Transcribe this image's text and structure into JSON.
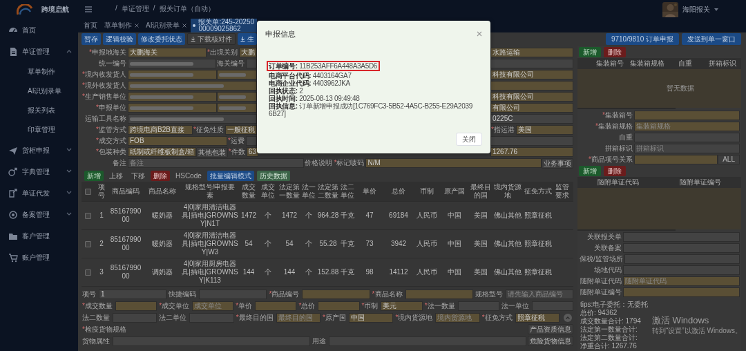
{
  "sidebar": {
    "app_name": "跨境启航",
    "items": [
      {
        "label": "首页"
      },
      {
        "label": "单证管理",
        "expanded": true,
        "children": [
          {
            "label": "草单制作"
          },
          {
            "label": "AI识别录单"
          },
          {
            "label": "报关列表"
          },
          {
            "label": "印章管理"
          }
        ]
      },
      {
        "label": "货柜申报",
        "expanded": false
      },
      {
        "label": "字典管理",
        "expanded": false
      },
      {
        "label": "单证代发",
        "expanded": false
      },
      {
        "label": "备案管理",
        "expanded": false
      },
      {
        "label": "客户管理"
      },
      {
        "label": "账户管理"
      }
    ]
  },
  "header": {
    "separator": "/",
    "breadcrumb": [
      "单证管理",
      "报关订单（自动）"
    ],
    "user": "海阳报关"
  },
  "tabs": [
    {
      "label": "首页",
      "selected": false,
      "closable": false
    },
    {
      "label": "草单制作",
      "selected": false,
      "closable": true
    },
    {
      "label": "AI识别录单",
      "selected": false,
      "closable": true
    },
    {
      "label": "报关单:245-2025000009025862",
      "selected": true,
      "closable": false
    }
  ],
  "toolbar": [
    {
      "label": "暂存",
      "kind": "primary"
    },
    {
      "label": "逻辑校验",
      "kind": "primary"
    },
    {
      "label": "修改委托状态",
      "kind": "primary"
    },
    {
      "label": "下载核对件",
      "kind": "download"
    },
    {
      "label": "生",
      "kind": "download-primary"
    }
  ],
  "actions": [
    {
      "label": "9710/9810 订单申报",
      "kind": "primary"
    },
    {
      "label": "发送到单一窗口",
      "kind": "primary"
    }
  ],
  "form": {
    "lines": [
      {
        "left": [
          {
            "kind": "label",
            "mark": "*",
            "text": "申报地海关"
          },
          {
            "kind": "input",
            "value": "大鹏海关",
            "required": true
          },
          {
            "kind": "label",
            "mark": "*",
            "text": "出境关别"
          },
          {
            "kind": "input",
            "value": "大鹏",
            "required": true
          }
        ],
        "right": [
          {
            "kind": "input",
            "value": "水路运输",
            "required": true
          }
        ]
      },
      {
        "left": [
          {
            "kind": "label",
            "text": "统一编号"
          },
          {
            "kind": "redacted",
            "required": false
          },
          {
            "kind": "label",
            "text": "海关编号"
          },
          {
            "kind": "input",
            "required": false
          }
        ],
        "right": [
          {
            "kind": "input",
            "required": false
          }
        ]
      },
      {
        "left": [
          {
            "kind": "label",
            "mark": "*",
            "text": "境内收发货人"
          },
          {
            "kind": "redacted",
            "required": true
          },
          {
            "kind": "redacted",
            "required": true
          }
        ],
        "right": [
          {
            "kind": "input",
            "value": "科技有限公司",
            "required": true
          }
        ]
      },
      {
        "left": [
          {
            "kind": "label",
            "mark": "*",
            "text": "境外收发货人"
          },
          {
            "kind": "redacted",
            "required": true
          }
        ],
        "right": [
          {
            "kind": "input",
            "required": true
          }
        ]
      },
      {
        "left": [
          {
            "kind": "label",
            "mark": "*",
            "text": "生产销售单位"
          },
          {
            "kind": "redacted",
            "required": true
          },
          {
            "kind": "redacted",
            "required": true
          }
        ],
        "right": [
          {
            "kind": "input",
            "value": "科技有限公司",
            "required": true
          }
        ]
      },
      {
        "left": [
          {
            "kind": "label",
            "mark": "*",
            "text": "申报单位"
          },
          {
            "kind": "redacted",
            "required": true
          },
          {
            "kind": "redacted",
            "required": true
          }
        ],
        "right": [
          {
            "kind": "input",
            "value": "有限公司",
            "required": true
          }
        ]
      },
      {
        "left": [
          {
            "kind": "label",
            "text": "运输工具名称"
          },
          {
            "kind": "redacted",
            "required": false
          }
        ],
        "right": [
          {
            "kind": "input",
            "value": "0225C",
            "required": false
          }
        ]
      },
      {
        "left": [
          {
            "kind": "label",
            "mark": "*",
            "text": "监管方式"
          },
          {
            "kind": "input",
            "value": "跨境电商B2B直接",
            "required": true
          },
          {
            "kind": "label",
            "mark": "*",
            "text": "征免性质"
          },
          {
            "kind": "input",
            "value": "一般征税",
            "required": true
          }
        ],
        "right": [
          {
            "kind": "label",
            "mark": "*",
            "text": "指运港"
          },
          {
            "kind": "input",
            "value": "美国",
            "required": true
          }
        ]
      },
      {
        "left": [
          {
            "kind": "label",
            "mark": "*",
            "text": "成交方式"
          },
          {
            "kind": "input",
            "value": "FOB",
            "required": true
          },
          {
            "kind": "label",
            "mark": "*",
            "text": "运费"
          },
          {
            "kind": "input",
            "required": false
          }
        ],
        "right": [
          {
            "kind": "input",
            "required": false
          }
        ]
      },
      {
        "left": [
          {
            "kind": "label",
            "mark": "*",
            "text": "包装种类"
          },
          {
            "kind": "input",
            "value": "纸制或纤维板制盒/箱",
            "required": true
          },
          {
            "kind": "button",
            "text": "其他包装"
          },
          {
            "kind": "label",
            "mark": "*",
            "text": "件数"
          },
          {
            "kind": "input",
            "value": "63",
            "required": true
          }
        ],
        "right": [
          {
            "kind": "input",
            "value": "1267.76",
            "required": true
          }
        ]
      },
      {
        "fields": [
          {
            "kind": "label",
            "text": "备注"
          },
          {
            "kind": "input",
            "placeholder": "备注",
            "required": false
          },
          {
            "kind": "label",
            "text": "价格说明"
          },
          {
            "kind": "label",
            "mark": "*",
            "text": "标记唛码"
          },
          {
            "kind": "input",
            "value": "N/M",
            "required": true
          },
          {
            "kind": "button",
            "text": "业务事项"
          }
        ]
      }
    ]
  },
  "goods": {
    "buttons": [
      {
        "label": "新增",
        "kind": "add"
      },
      {
        "label": "上移",
        "kind": "plain"
      },
      {
        "label": "下移",
        "kind": "plain"
      },
      {
        "label": "删除",
        "kind": "delete"
      },
      {
        "label": "HSCode",
        "kind": "plain"
      },
      {
        "label": "批量编辑模式",
        "kind": "primary"
      },
      {
        "label": "历史数据",
        "kind": "history"
      }
    ],
    "all_checked": false,
    "columns": [
      "项号",
      "商品编码",
      "商品名称",
      "规格型号/申报要素",
      "成交数量",
      "成交单位",
      "法定第一数量",
      "法一单位",
      "法定第二数量",
      "法二单位",
      "单价",
      "总价",
      "币制",
      "原产国",
      "最终目的国",
      "境内货源地",
      "征免方式",
      "监管要求"
    ],
    "rows": [
      {
        "checked": false,
        "cells": [
          "1",
          "8516799000",
          "暖奶器",
          "4|0|家用清洁电器具|插电|GROWNSY|N1T",
          "1472",
          "个",
          "1472",
          "个",
          "964.28",
          "千克",
          "47",
          "69184",
          "人民币",
          "中国",
          "美国",
          "佛山其他",
          "照章征税",
          ""
        ]
      },
      {
        "checked": false,
        "cells": [
          "2",
          "8516799000",
          "暖奶器",
          "4|0|家用清洁电器具|插电|GROWNSY|W3",
          "54",
          "个",
          "54",
          "个",
          "55.28",
          "千克",
          "73",
          "3942",
          "人民币",
          "中国",
          "美国",
          "佛山其他",
          "照章征税",
          ""
        ]
      },
      {
        "checked": false,
        "cells": [
          "3",
          "8516799000",
          "调奶器",
          "4|0|家用厨房电器具|插电|GROWNSY|K113",
          "144",
          "个",
          "144",
          "个",
          "152.88",
          "千克",
          "98",
          "14112",
          "人民币",
          "中国",
          "美国",
          "佛山其他",
          "照章征税",
          ""
        ]
      }
    ]
  },
  "goods_form": {
    "lines": [
      {
        "fields": [
          {
            "kind": "label",
            "text": "项号"
          },
          {
            "kind": "input",
            "value": "1",
            "required": false
          },
          {
            "kind": "label",
            "text": "快捷编码"
          },
          {
            "kind": "input",
            "required": false
          },
          {
            "kind": "label",
            "mark": "*",
            "text": "商品编号"
          },
          {
            "kind": "input",
            "required": true
          },
          {
            "kind": "label",
            "mark": "*",
            "text": "商品名称"
          },
          {
            "kind": "input",
            "required": true
          },
          {
            "kind": "label",
            "text": "规格型号"
          },
          {
            "kind": "input",
            "placeholder": "请先输入商品编号",
            "required": false
          }
        ]
      },
      {
        "fields": [
          {
            "kind": "label",
            "mark": "*",
            "text": "成交数量"
          },
          {
            "kind": "input",
            "required": true
          },
          {
            "kind": "label",
            "mark": "*",
            "text": "成交单位"
          },
          {
            "kind": "input",
            "placeholder": "成交单位",
            "required": true
          },
          {
            "kind": "label",
            "mark": "*",
            "text": "单价"
          },
          {
            "kind": "input",
            "required": true
          },
          {
            "kind": "label",
            "mark": "*",
            "text": "总价"
          },
          {
            "kind": "input",
            "required": true
          },
          {
            "kind": "label",
            "mark": "*",
            "text": "币制"
          },
          {
            "kind": "input",
            "value": "美元",
            "required": true
          },
          {
            "kind": "label",
            "mark": "*",
            "text": "法一数量"
          },
          {
            "kind": "input",
            "required": false
          },
          {
            "kind": "label",
            "text": "法一单位"
          },
          {
            "kind": "input",
            "required": false
          }
        ]
      },
      {
        "fields": [
          {
            "kind": "label",
            "text": "法二数量"
          },
          {
            "kind": "input",
            "required": false
          },
          {
            "kind": "label",
            "text": "法二单位"
          },
          {
            "kind": "input",
            "required": false
          },
          {
            "kind": "label",
            "mark": "*",
            "text": "最终目的国"
          },
          {
            "kind": "input",
            "placeholder": "最终目的国",
            "required": true
          },
          {
            "kind": "label",
            "mark": "*",
            "text": "原产国"
          },
          {
            "kind": "input",
            "value": "中国",
            "required": true
          },
          {
            "kind": "label",
            "mark": "*",
            "text": "境内货源地"
          },
          {
            "kind": "input",
            "placeholder": "境内货源地",
            "required": true
          },
          {
            "kind": "label",
            "mark": "*",
            "text": "征免方式"
          },
          {
            "kind": "input",
            "value": "照章征税",
            "required": true
          },
          {
            "kind": "collapse"
          }
        ]
      },
      {
        "fields": [
          {
            "kind": "label",
            "mark": "*",
            "text": "检疫货物规格"
          },
          {
            "kind": "button",
            "text": "产品资质信息"
          }
        ]
      },
      {
        "fields": [
          {
            "kind": "label",
            "text": "货物属性"
          },
          {
            "kind": "input",
            "required": false
          },
          {
            "kind": "label",
            "text": "用途"
          },
          {
            "kind": "input",
            "required": false
          },
          {
            "kind": "button",
            "text": "危险货物信息"
          }
        ]
      }
    ]
  },
  "containers": {
    "buttons": [
      {
        "label": "新增",
        "kind": "add"
      },
      {
        "label": "删除",
        "kind": "delete"
      }
    ],
    "columns": [
      "集装箱号",
      "集装箱规格",
      "自重",
      "拼箱标识"
    ],
    "empty_text": "暂无数据",
    "form": [
      {
        "fields": [
          {
            "kind": "label",
            "mark": "*",
            "text": "集装箱号"
          },
          {
            "kind": "input",
            "required": true
          }
        ]
      },
      {
        "fields": [
          {
            "kind": "label",
            "mark": "*",
            "text": "集装箱规格"
          },
          {
            "kind": "input",
            "placeholder": "集装箱规格",
            "required": true
          }
        ]
      },
      {
        "fields": [
          {
            "kind": "label",
            "text": "自重"
          },
          {
            "kind": "input",
            "required": false
          }
        ]
      },
      {
        "fields": [
          {
            "kind": "label",
            "text": "拼箱标识"
          },
          {
            "kind": "input",
            "placeholder": "拼箱标识",
            "required": false
          }
        ]
      },
      {
        "fields": [
          {
            "kind": "label",
            "mark": "*",
            "text": "商品项号关系"
          },
          {
            "kind": "input",
            "required": true
          },
          {
            "kind": "addon",
            "text": "ALL"
          }
        ]
      }
    ]
  },
  "documents": {
    "buttons": [
      {
        "label": "新增",
        "kind": "add"
      },
      {
        "label": "删除",
        "kind": "delete"
      }
    ],
    "columns": [
      "随附单证代码",
      "随附单证编号"
    ],
    "form": [
      {
        "fields": [
          {
            "kind": "label",
            "text": "关联报关单"
          },
          {
            "kind": "input",
            "required": false
          }
        ]
      },
      {
        "fields": [
          {
            "kind": "label",
            "text": "关联备案"
          },
          {
            "kind": "input",
            "required": false
          }
        ]
      },
      {
        "fields": [
          {
            "kind": "label",
            "text": "保税/监管场所"
          },
          {
            "kind": "input",
            "required": false
          }
        ]
      },
      {
        "fields": [
          {
            "kind": "label",
            "text": "场地代码"
          },
          {
            "kind": "input",
            "required": false
          }
        ]
      },
      {
        "fields": [
          {
            "kind": "label",
            "text": "随附单证代码"
          },
          {
            "kind": "input",
            "placeholder": "随附单证代码",
            "required": true
          }
        ]
      },
      {
        "fields": [
          {
            "kind": "label",
            "text": "随附单证编号"
          },
          {
            "kind": "input",
            "required": true
          }
        ]
      }
    ]
  },
  "tips": [
    "tips:电子委托：无委托",
    "总价: 94362",
    "成交数量合计: 1794",
    "法定第一数量合计:",
    "法定第二数量合计:",
    "净重合计: 1267.76"
  ],
  "os_notice": {
    "title": "激活 Windows",
    "text": "转到“设置”以激活 Windows。"
  },
  "dialog": {
    "title": "申报信息",
    "lines": [
      {
        "text": "**订单编号:** 11B253AFF6A448A3A5D6",
        "highlighted": true
      },
      {
        "text": "**电商平台代码:** 4403164GA7",
        "highlighted": false
      },
      {
        "text": "**电商企业代码:** 4403962JKA",
        "highlighted": false
      },
      {
        "text": "**回执状态:** 2",
        "highlighted": false
      },
      {
        "text": "**回执时间:** 2025-08-13 09:49:48",
        "highlighted": false
      },
      {
        "text": "**回执信息:** 订单新增申报成功[1C769FC3-5B52-4A5C-B255-E29A20396B27]",
        "highlighted": false
      }
    ],
    "button": "关闭"
  }
}
